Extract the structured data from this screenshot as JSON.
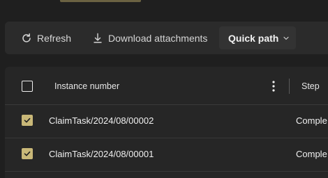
{
  "toolbar": {
    "refresh_label": "Refresh",
    "download_label": "Download attachments",
    "quick_path_label": "Quick path"
  },
  "grid": {
    "columns": {
      "instance": "Instance number",
      "step": "Step"
    },
    "rows": [
      {
        "instance": "ClaimTask/2024/08/00002",
        "step": "Comple",
        "selected": true
      },
      {
        "instance": "ClaimTask/2024/08/00001",
        "step": "Comple",
        "selected": true
      }
    ]
  },
  "colors": {
    "accent": "#c9b878",
    "background": "#1f1f1f",
    "toolbar": "#2b2b2b",
    "grid": "#262626"
  },
  "icons": {
    "refresh": "refresh-icon",
    "download": "download-icon",
    "chevron": "chevron-down-icon",
    "more": "more-vertical-icon",
    "check": "checkmark-icon"
  }
}
